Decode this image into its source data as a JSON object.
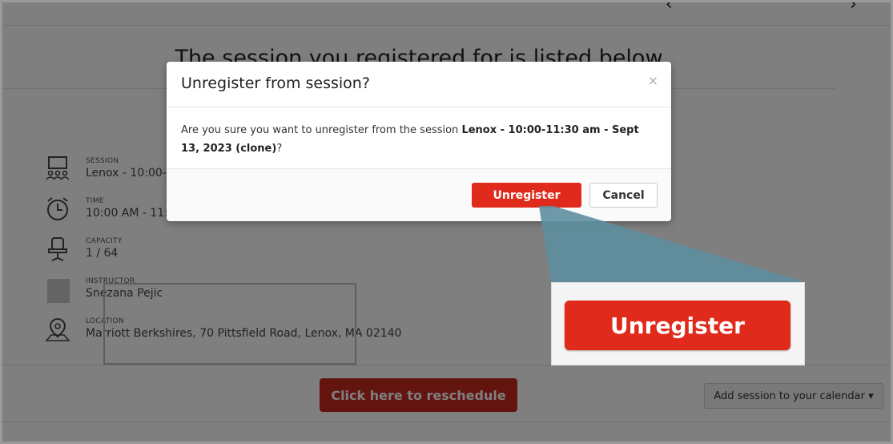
{
  "page": {
    "heading": "The session you registered for is listed below",
    "details": [
      {
        "label": "SESSION",
        "value": "Lenox - 10:00-1",
        "icon": "session-icon"
      },
      {
        "label": "TIME",
        "value": "10:00 AM - 11:",
        "icon": "clock-icon"
      },
      {
        "label": "CAPACITY",
        "value": "1 / 64",
        "icon": "chair-icon"
      },
      {
        "label": "INSTRUCTOR",
        "value": "Snezana Pejic",
        "icon": "avatar-icon"
      },
      {
        "label": "LOCATION",
        "value": "Marriott Berkshires, 70 Pittsfield Road, Lenox, MA 02140",
        "icon": "map-pin-icon"
      }
    ],
    "reschedule_label": "Click here to reschedule",
    "calendar_label": "Add session to your calendar ▾"
  },
  "modal": {
    "title": "Unregister from session?",
    "close_symbol": "×",
    "body_prefix": "Are you sure you want to unregister from the session ",
    "body_session": "Lenox - 10:00-11:30 am - Sept 13, 2023 (clone)",
    "body_suffix": "?",
    "unregister_label": "Unregister",
    "cancel_label": "Cancel"
  },
  "zoom": {
    "label": "Unregister"
  },
  "colors": {
    "accent_red": "#e02b1c",
    "dim_overlay": "rgba(0,0,0,0.5)",
    "callout": "#5e8e9e"
  }
}
